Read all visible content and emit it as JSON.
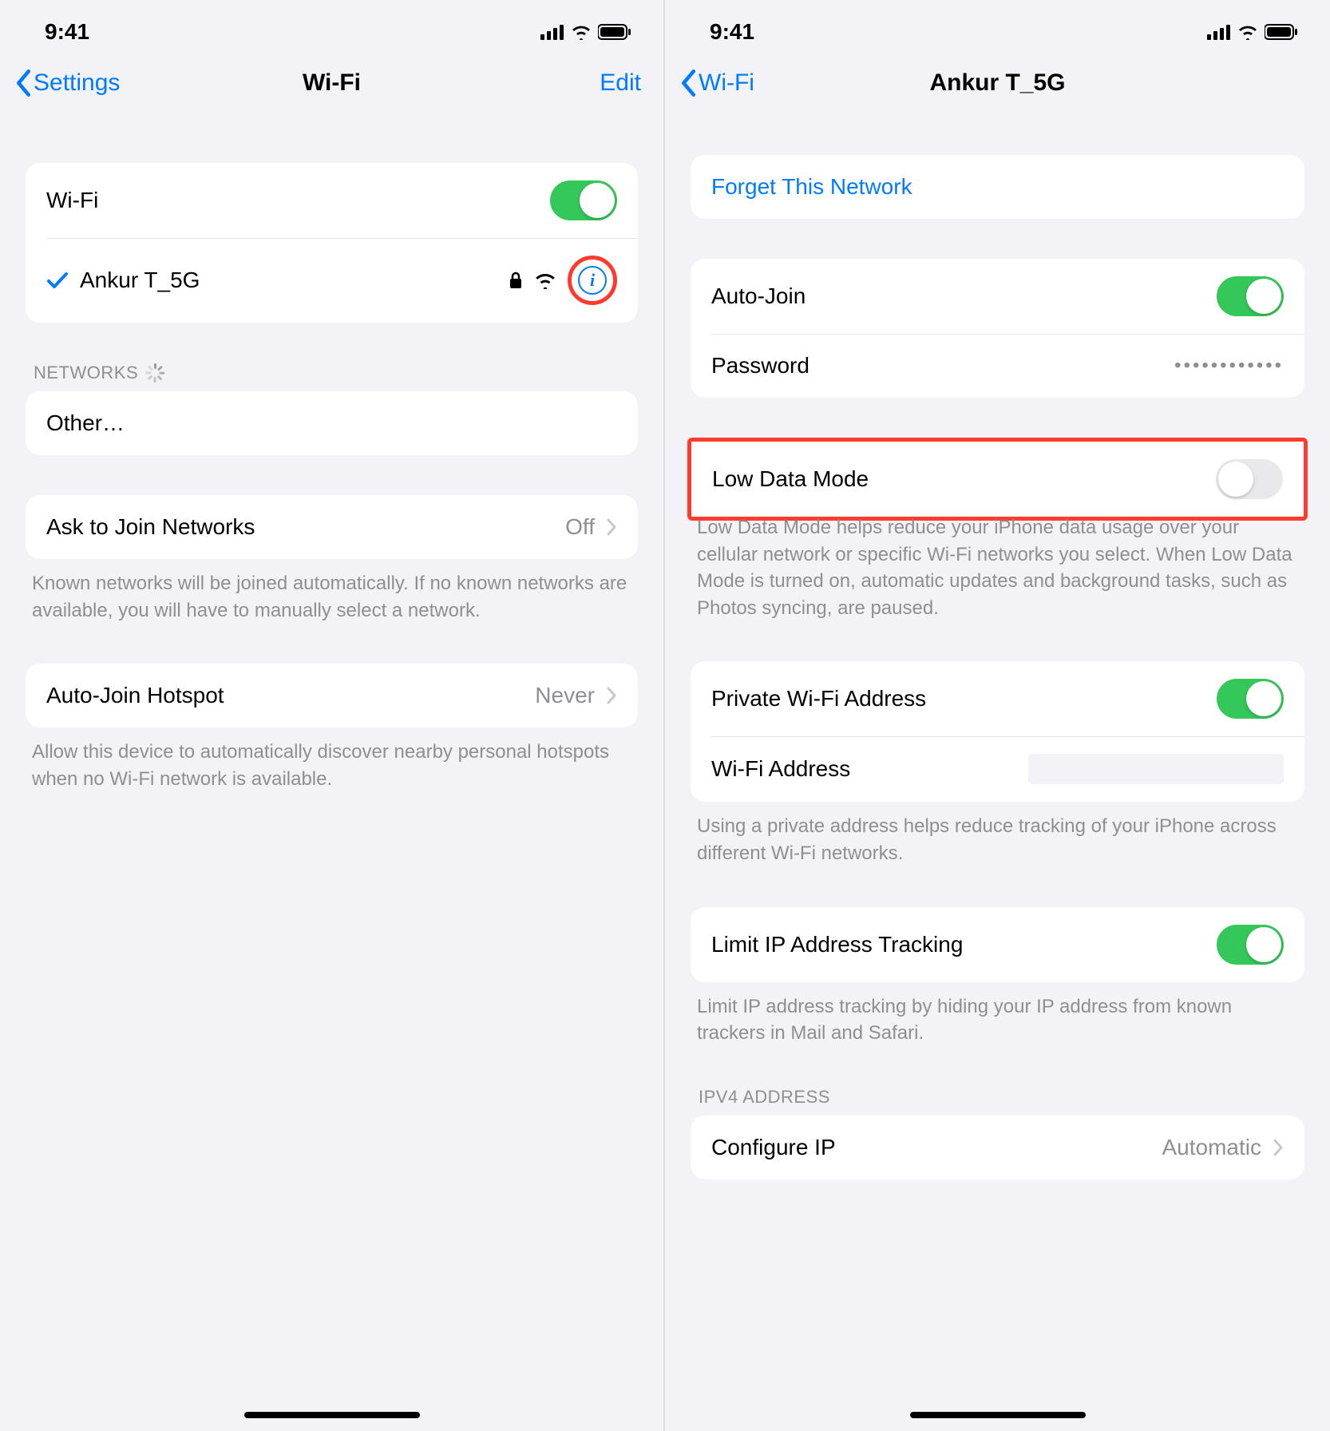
{
  "status": {
    "time": "9:41"
  },
  "left": {
    "back": "Settings",
    "title": "Wi-Fi",
    "edit": "Edit",
    "wifi_label": "Wi-Fi",
    "connected_name": "Ankur T_5G",
    "networks_header": "NETWORKS",
    "other_label": "Other…",
    "ask_label": "Ask to Join Networks",
    "ask_value": "Off",
    "ask_footer": "Known networks will be joined automatically. If no known networks are available, you will have to manually select a network.",
    "hotspot_label": "Auto-Join Hotspot",
    "hotspot_value": "Never",
    "hotspot_footer": "Allow this device to automatically discover nearby personal hotspots when no Wi-Fi network is available."
  },
  "right": {
    "back": "Wi-Fi",
    "title": "Ankur T_5G",
    "forget": "Forget This Network",
    "autojoin_label": "Auto-Join",
    "password_label": "Password",
    "password_value": "••••••••••••",
    "lowdata_label": "Low Data Mode",
    "lowdata_footer": "Low Data Mode helps reduce your iPhone data usage over your cellular network or specific Wi-Fi networks you select. When Low Data Mode is turned on, automatic updates and background tasks, such as Photos syncing, are paused.",
    "private_label": "Private Wi-Fi Address",
    "wifiaddr_label": "Wi-Fi Address",
    "private_footer": "Using a private address helps reduce tracking of your iPhone across different Wi-Fi networks.",
    "limit_label": "Limit IP Address Tracking",
    "limit_footer": "Limit IP address tracking by hiding your IP address from known trackers in Mail and Safari.",
    "ipv4_header": "IPV4 ADDRESS",
    "configip_label": "Configure IP",
    "configip_value": "Automatic"
  }
}
